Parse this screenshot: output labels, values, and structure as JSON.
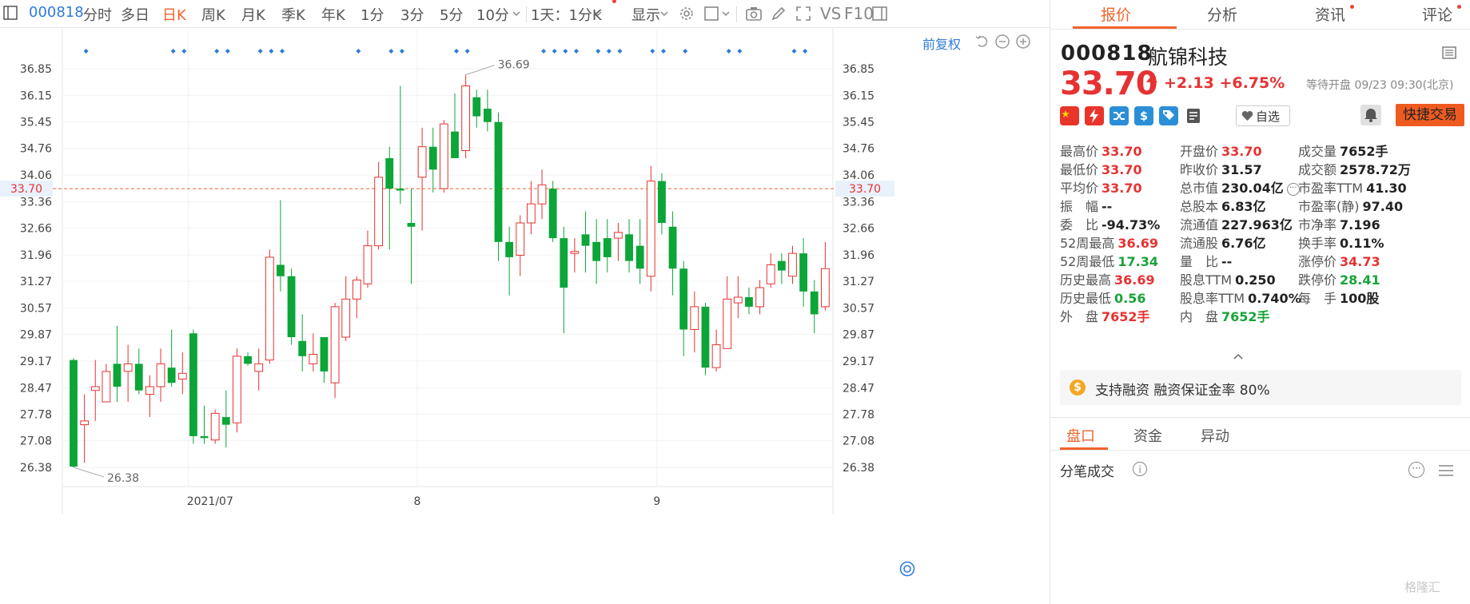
{
  "toolbar": {
    "code": "000818",
    "periods": [
      "分时",
      "多日",
      "日K",
      "周K",
      "月K",
      "季K",
      "年K",
      "1分",
      "3分",
      "5分",
      "10分"
    ],
    "active_period": "日K",
    "interval_select": "1天：1分K",
    "display_label": "显示",
    "vs_label": "VS",
    "f10_label": "F10"
  },
  "chart": {
    "restore_label": "前复权",
    "current_price_label": "33.70",
    "max_label": "36.69",
    "min_label": "26.38",
    "y_ticks": [
      "36.85",
      "36.15",
      "35.45",
      "34.76",
      "34.06",
      "33.36",
      "32.66",
      "31.96",
      "31.27",
      "30.57",
      "29.87",
      "29.17",
      "28.47",
      "27.78",
      "27.08",
      "26.38"
    ],
    "x_labels": [
      "2021/07",
      "8",
      "9"
    ]
  },
  "chart_data": {
    "type": "candlestick",
    "y_range": [
      26.38,
      36.85
    ],
    "x_labels": [
      "2021/07",
      "8",
      "9"
    ],
    "current_price": 33.7,
    "max": 36.69,
    "min": 26.38,
    "candles": [
      {
        "o": 29.2,
        "h": 29.25,
        "l": 26.38,
        "c": 26.4
      },
      {
        "o": 27.5,
        "h": 28.3,
        "l": 26.5,
        "c": 27.6
      },
      {
        "o": 28.4,
        "h": 29.2,
        "l": 27.6,
        "c": 28.5
      },
      {
        "o": 28.1,
        "h": 29.1,
        "l": 28.1,
        "c": 28.9
      },
      {
        "o": 29.1,
        "h": 30.1,
        "l": 28.1,
        "c": 28.5
      },
      {
        "o": 28.9,
        "h": 29.6,
        "l": 28.1,
        "c": 29.1
      },
      {
        "o": 29.1,
        "h": 29.5,
        "l": 28.3,
        "c": 28.4
      },
      {
        "o": 28.3,
        "h": 28.8,
        "l": 27.7,
        "c": 28.5
      },
      {
        "o": 28.5,
        "h": 29.5,
        "l": 28.1,
        "c": 29.1
      },
      {
        "o": 29.0,
        "h": 30.0,
        "l": 28.5,
        "c": 28.6
      },
      {
        "o": 28.7,
        "h": 29.4,
        "l": 28.3,
        "c": 28.85
      },
      {
        "o": 29.9,
        "h": 30.0,
        "l": 27.0,
        "c": 27.2
      },
      {
        "o": 27.2,
        "h": 28.0,
        "l": 27.0,
        "c": 27.15
      },
      {
        "o": 27.1,
        "h": 27.9,
        "l": 27.0,
        "c": 27.8
      },
      {
        "o": 27.7,
        "h": 28.4,
        "l": 26.9,
        "c": 27.5
      },
      {
        "o": 27.55,
        "h": 29.5,
        "l": 27.3,
        "c": 29.3
      },
      {
        "o": 29.3,
        "h": 29.4,
        "l": 29.05,
        "c": 29.1
      },
      {
        "o": 28.9,
        "h": 29.5,
        "l": 28.4,
        "c": 29.1
      },
      {
        "o": 29.2,
        "h": 32.1,
        "l": 29.1,
        "c": 31.9
      },
      {
        "o": 31.7,
        "h": 33.4,
        "l": 31.0,
        "c": 31.4
      },
      {
        "o": 31.4,
        "h": 31.6,
        "l": 29.6,
        "c": 29.8
      },
      {
        "o": 29.7,
        "h": 30.4,
        "l": 28.9,
        "c": 29.3
      },
      {
        "o": 29.1,
        "h": 29.9,
        "l": 28.9,
        "c": 29.35
      },
      {
        "o": 29.8,
        "h": 29.8,
        "l": 28.6,
        "c": 28.9
      },
      {
        "o": 28.6,
        "h": 30.7,
        "l": 28.2,
        "c": 30.6
      },
      {
        "o": 29.8,
        "h": 31.4,
        "l": 29.7,
        "c": 30.8
      },
      {
        "o": 30.8,
        "h": 31.4,
        "l": 30.3,
        "c": 31.3
      },
      {
        "o": 31.2,
        "h": 32.6,
        "l": 31.1,
        "c": 32.2
      },
      {
        "o": 32.2,
        "h": 34.4,
        "l": 32.1,
        "c": 34.0
      },
      {
        "o": 34.5,
        "h": 34.8,
        "l": 32.1,
        "c": 33.7
      },
      {
        "o": 33.7,
        "h": 36.4,
        "l": 33.3,
        "c": 33.65
      },
      {
        "o": 32.8,
        "h": 33.7,
        "l": 31.2,
        "c": 32.7
      },
      {
        "o": 34.0,
        "h": 35.3,
        "l": 32.6,
        "c": 34.8
      },
      {
        "o": 34.8,
        "h": 35.3,
        "l": 33.6,
        "c": 34.2
      },
      {
        "o": 33.7,
        "h": 35.5,
        "l": 33.6,
        "c": 35.4
      },
      {
        "o": 35.2,
        "h": 36.2,
        "l": 34.6,
        "c": 34.5
      },
      {
        "o": 34.7,
        "h": 36.69,
        "l": 34.5,
        "c": 36.4
      },
      {
        "o": 36.1,
        "h": 36.3,
        "l": 35.3,
        "c": 35.6
      },
      {
        "o": 35.8,
        "h": 36.3,
        "l": 35.2,
        "c": 35.45
      },
      {
        "o": 35.45,
        "h": 35.7,
        "l": 31.8,
        "c": 32.3
      },
      {
        "o": 32.3,
        "h": 32.7,
        "l": 30.9,
        "c": 31.9
      },
      {
        "o": 31.95,
        "h": 33.0,
        "l": 31.4,
        "c": 32.8
      },
      {
        "o": 32.8,
        "h": 33.9,
        "l": 32.5,
        "c": 33.3
      },
      {
        "o": 33.3,
        "h": 34.2,
        "l": 32.9,
        "c": 33.8
      },
      {
        "o": 33.7,
        "h": 33.9,
        "l": 32.3,
        "c": 32.4
      },
      {
        "o": 32.4,
        "h": 32.7,
        "l": 29.9,
        "c": 31.1
      },
      {
        "o": 32.0,
        "h": 32.4,
        "l": 31.5,
        "c": 32.05
      },
      {
        "o": 32.5,
        "h": 33.1,
        "l": 31.5,
        "c": 32.2
      },
      {
        "o": 32.3,
        "h": 32.9,
        "l": 31.2,
        "c": 31.8
      },
      {
        "o": 32.4,
        "h": 32.9,
        "l": 31.5,
        "c": 31.9
      },
      {
        "o": 32.4,
        "h": 32.8,
        "l": 31.8,
        "c": 32.55
      },
      {
        "o": 32.5,
        "h": 32.9,
        "l": 31.5,
        "c": 31.8
      },
      {
        "o": 32.2,
        "h": 32.9,
        "l": 31.2,
        "c": 31.6
      },
      {
        "o": 31.4,
        "h": 34.3,
        "l": 31.0,
        "c": 33.9
      },
      {
        "o": 33.9,
        "h": 34.1,
        "l": 32.5,
        "c": 32.8
      },
      {
        "o": 32.7,
        "h": 33.1,
        "l": 30.9,
        "c": 31.6
      },
      {
        "o": 31.6,
        "h": 31.8,
        "l": 29.3,
        "c": 30.0
      },
      {
        "o": 30.0,
        "h": 31.0,
        "l": 29.4,
        "c": 30.6
      },
      {
        "o": 30.6,
        "h": 30.7,
        "l": 28.8,
        "c": 29.0
      },
      {
        "o": 29.0,
        "h": 30.0,
        "l": 28.9,
        "c": 29.6
      },
      {
        "o": 29.5,
        "h": 31.4,
        "l": 29.5,
        "c": 30.8
      },
      {
        "o": 30.7,
        "h": 31.4,
        "l": 30.3,
        "c": 30.85
      },
      {
        "o": 30.85,
        "h": 31.1,
        "l": 30.4,
        "c": 30.6
      },
      {
        "o": 30.6,
        "h": 31.3,
        "l": 30.4,
        "c": 31.1
      },
      {
        "o": 31.2,
        "h": 32.0,
        "l": 31.1,
        "c": 31.7
      },
      {
        "o": 31.8,
        "h": 32.0,
        "l": 31.2,
        "c": 31.55
      },
      {
        "o": 31.4,
        "h": 32.2,
        "l": 31.2,
        "c": 32.0
      },
      {
        "o": 32.0,
        "h": 32.4,
        "l": 30.6,
        "c": 31.0
      },
      {
        "o": 31.0,
        "h": 31.3,
        "l": 29.9,
        "c": 30.4
      },
      {
        "o": 30.6,
        "h": 32.3,
        "l": 30.5,
        "c": 31.6
      }
    ],
    "event_marker_indices": [
      2,
      10,
      11,
      14,
      15,
      18,
      19,
      20,
      27,
      30,
      31,
      36,
      37,
      44,
      45,
      46,
      47,
      49,
      50,
      51,
      54,
      55,
      57,
      61,
      62,
      67,
      68
    ]
  },
  "panel": {
    "tabs": [
      {
        "label": "报价",
        "dot": false
      },
      {
        "label": "分析",
        "dot": false
      },
      {
        "label": "资讯",
        "dot": true
      },
      {
        "label": "评论",
        "dot": true
      }
    ],
    "code": "000818",
    "name": "航锦科技",
    "price": "33.70",
    "change": "+2.13",
    "change_pct": "+6.75%",
    "status": "等待开盘 09/23 09:30(北京)",
    "badges": [
      "cn-flag-icon",
      "lightning-icon",
      "shuffle-icon",
      "dollar-icon",
      "tag-icon",
      "doc-icon"
    ],
    "watch_label": "自选",
    "trade_label": "快捷交易",
    "stats": [
      [
        {
          "label": "最高价",
          "value": "33.70",
          "color": "up"
        },
        {
          "label": "开盘价",
          "value": "33.70",
          "color": "up"
        },
        {
          "label": "成交量",
          "value": "7652手",
          "color": ""
        }
      ],
      [
        {
          "label": "最低价",
          "value": "33.70",
          "color": "up"
        },
        {
          "label": "昨收价",
          "value": "31.57",
          "color": ""
        },
        {
          "label": "成交额",
          "value": "2578.72万",
          "color": ""
        }
      ],
      [
        {
          "label": "平均价",
          "value": "33.70",
          "color": "up"
        },
        {
          "label": "总市值",
          "value": "230.04亿",
          "color": ""
        },
        {
          "label": "市盈率TTM",
          "value": "41.30",
          "color": ""
        }
      ],
      [
        {
          "label": "振　幅",
          "value": "--",
          "color": ""
        },
        {
          "label": "总股本",
          "value": "6.83亿",
          "color": ""
        },
        {
          "label": "市盈率(静)",
          "value": "97.40",
          "color": ""
        }
      ],
      [
        {
          "label": "委　比",
          "value": "-94.73%",
          "color": ""
        },
        {
          "label": "流通值",
          "value": "227.963亿",
          "color": ""
        },
        {
          "label": "市净率",
          "value": "7.196",
          "color": ""
        }
      ],
      [
        {
          "label": "52周最高",
          "value": "36.69",
          "color": "up"
        },
        {
          "label": "流通股",
          "value": "6.76亿",
          "color": ""
        },
        {
          "label": "换手率",
          "value": "0.11%",
          "color": ""
        }
      ],
      [
        {
          "label": "52周最低",
          "value": "17.34",
          "color": "dn"
        },
        {
          "label": "量　比",
          "value": "--",
          "color": ""
        },
        {
          "label": "涨停价",
          "value": "34.73",
          "color": "up"
        }
      ],
      [
        {
          "label": "历史最高",
          "value": "36.69",
          "color": "up"
        },
        {
          "label": "股息TTM",
          "value": "0.250",
          "color": ""
        },
        {
          "label": "跌停价",
          "value": "28.41",
          "color": "dn"
        }
      ],
      [
        {
          "label": "历史最低",
          "value": "0.56",
          "color": "dn"
        },
        {
          "label": "股息率TTM",
          "value": "0.740%",
          "color": ""
        },
        {
          "label": "每　手",
          "value": "100股",
          "color": ""
        }
      ],
      [
        {
          "label": "外　盘",
          "value": "7652手",
          "color": "up"
        },
        {
          "label": "内　盘",
          "value": "7652手",
          "color": "dn"
        }
      ]
    ],
    "margin_text": "支持融资 融资保证金率 80%",
    "margin_icon": "$",
    "subtabs": [
      "盘口",
      "资金",
      "异动"
    ],
    "ticks_title": "分笔成交"
  },
  "watermark": "格隆汇",
  "colors": {
    "up": "#e63232",
    "down": "#0ba538",
    "accent": "#f0642d",
    "link": "#2f7bd9"
  }
}
